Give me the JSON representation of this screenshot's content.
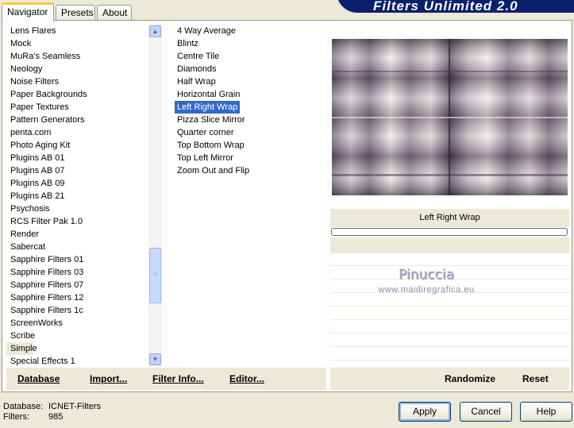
{
  "window": {
    "title": "Filters Unlimited 2.0"
  },
  "tabs": [
    {
      "label": "Navigator",
      "active": true
    },
    {
      "label": "Presets",
      "active": false
    },
    {
      "label": "About",
      "active": false
    }
  ],
  "categories": {
    "items": [
      "Lens Flares",
      "Mock",
      "MuRa's Seamless",
      "Neology",
      "Noise Filters",
      "Paper Backgrounds",
      "Paper Textures",
      "Pattern Generators",
      "penta.com",
      "Photo Aging Kit",
      "Plugins AB 01",
      "Plugins AB 07",
      "Plugins AB 09",
      "Plugins AB 21",
      "Psychosis",
      "RCS Filter Pak 1.0",
      "Render",
      "Sabercat",
      "Sapphire Filters 01",
      "Sapphire Filters 03",
      "Sapphire Filters 07",
      "Sapphire Filters 12",
      "Sapphire Filters 1c",
      "ScreenWorks",
      "Scribe",
      "Simple",
      "Special Effects 1"
    ],
    "selected": "Simple"
  },
  "filters": {
    "items": [
      "4 Way Average",
      "Blintz",
      "Centre Tile",
      "Diamonds",
      "Half Wrap",
      "Horizontal Grain",
      "Left Right Wrap",
      "Pizza Slice Mirror",
      "Quarter corner",
      "Top Bottom Wrap",
      "Top Left Mirror",
      "Zoom Out and Flip"
    ],
    "selected": "Left Right Wrap"
  },
  "preview": {
    "filter_name": "Left Right Wrap",
    "watermark": "Pinuccia",
    "watermark_url": "www.maidiregrafica.eu"
  },
  "left_actions": {
    "database_label": "Database",
    "import_label": "Import...",
    "filter_info_label": "Filter Info...",
    "editor_label": "Editor..."
  },
  "right_actions": {
    "randomize_label": "Randomize",
    "reset_label": "Reset"
  },
  "status": {
    "database_label": "Database:",
    "database_value": "ICNET-Filters",
    "filters_label": "Filters:",
    "filters_value": "985"
  },
  "dialog_buttons": {
    "apply_label": "Apply",
    "cancel_label": "Cancel",
    "help_label": "Help"
  },
  "colors": {
    "selection": "#316ac5",
    "banner": "#0a1f6e",
    "dialog_background": "#ece9d8"
  }
}
